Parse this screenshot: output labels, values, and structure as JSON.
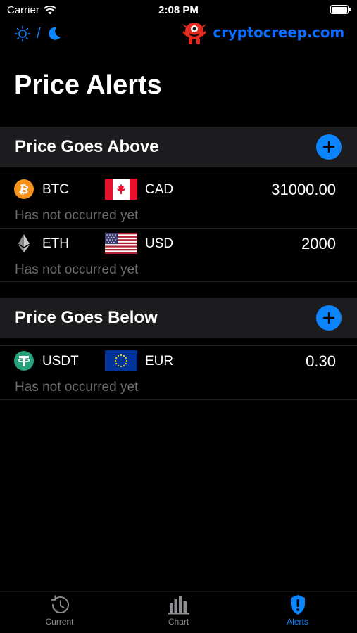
{
  "status_bar": {
    "carrier": "Carrier",
    "time": "2:08 PM",
    "battery_level": 1.0
  },
  "theme_toggle": {
    "separator": "/"
  },
  "logo": {
    "text": "cryptocreep.com"
  },
  "page": {
    "title": "Price Alerts"
  },
  "sections": [
    {
      "title": "Price Goes Above",
      "rows": [
        {
          "coin": "BTC",
          "coin_icon": "bitcoin-icon",
          "fiat": "CAD",
          "flag": "canada-flag",
          "value": "31000.00",
          "note": "Has not occurred yet"
        },
        {
          "coin": "ETH",
          "coin_icon": "ethereum-icon",
          "fiat": "USD",
          "flag": "usa-flag",
          "value": "2000",
          "note": "Has not occurred yet"
        }
      ]
    },
    {
      "title": "Price Goes Below",
      "rows": [
        {
          "coin": "USDT",
          "coin_icon": "tether-icon",
          "fiat": "EUR",
          "flag": "eu-flag",
          "value": "0.30",
          "note": "Has not occurred yet"
        }
      ]
    }
  ],
  "tabs": [
    {
      "label": "Current",
      "icon": "history-icon",
      "active": false
    },
    {
      "label": "Chart",
      "icon": "bar-chart-icon",
      "active": false
    },
    {
      "label": "Alerts",
      "icon": "shield-alert-icon",
      "active": true
    }
  ],
  "colors": {
    "accent": "#0a84ff",
    "section_bg": "#1c1c1e",
    "muted_text": "#6b6b70",
    "bitcoin": "#f7931a",
    "tether": "#26a17b",
    "logo_red": "#e52b1f"
  }
}
